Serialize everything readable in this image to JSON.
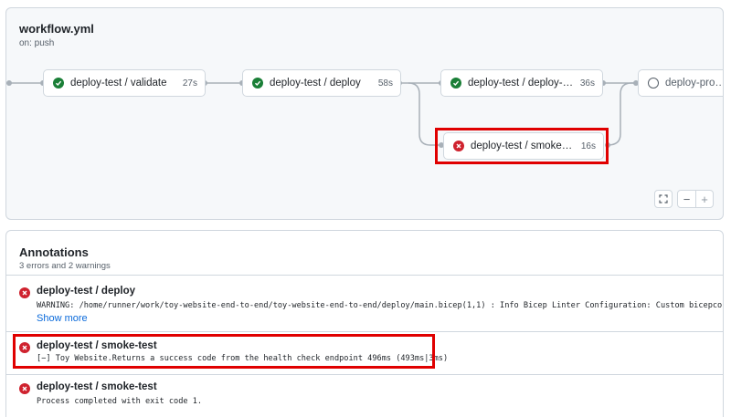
{
  "workflow": {
    "title": "workflow.yml",
    "trigger": "on: push",
    "jobs": [
      {
        "name": "deploy-test / validate",
        "duration": "27s",
        "status": "success",
        "status_icon": "check-circle-icon"
      },
      {
        "name": "deploy-test / deploy",
        "duration": "58s",
        "status": "success",
        "status_icon": "check-circle-icon"
      },
      {
        "name": "deploy-test / deploy-web…",
        "duration": "36s",
        "status": "success",
        "status_icon": "check-circle-icon"
      },
      {
        "name": "deploy-test / smoke-test",
        "duration": "16s",
        "status": "failure",
        "status_icon": "x-circle-icon"
      },
      {
        "name": "deploy-product",
        "duration": "",
        "status": "pending",
        "status_icon": "empty-circle-icon"
      }
    ],
    "zoom_controls": {
      "fullscreen_icon": "fullscreen-icon",
      "zoom_out_label": "−",
      "zoom_in_label": "+"
    }
  },
  "annotations": {
    "title": "Annotations",
    "summary": "3 errors and 2 warnings",
    "items": [
      {
        "job": "deploy-test / deploy",
        "message": "WARNING: /home/runner/work/toy-website-end-to-end/toy-website-end-to-end/deploy/main.bicep(1,1) : Info Bicep Linter Configuration: Custom bicepconfi…",
        "link": "Show more",
        "level": "error"
      },
      {
        "job": "deploy-test / smoke-test",
        "message": "[−] Toy Website.Returns a success code from the health check endpoint 496ms (493ms|3ms)",
        "level": "error"
      },
      {
        "job": "deploy-test / smoke-test",
        "message": "Process completed with exit code 1.",
        "level": "error"
      }
    ]
  },
  "colors": {
    "success": "#1a7f37",
    "failure": "#cf222e",
    "highlight": "#e00000",
    "link": "#0969da"
  }
}
